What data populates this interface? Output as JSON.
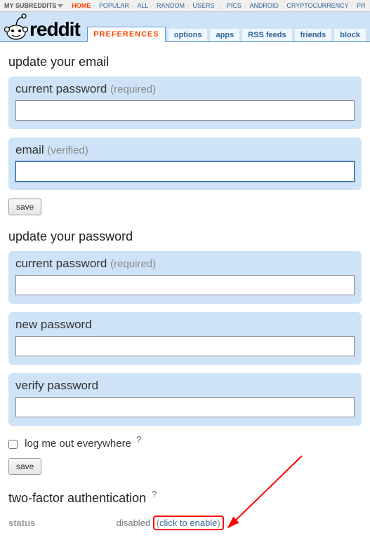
{
  "topbar": {
    "label": "MY SUBREDDITS",
    "links": [
      "HOME",
      "POPULAR",
      "ALL",
      "RANDOM",
      "USERS"
    ],
    "subs": [
      "PICS",
      "ANDROID",
      "CRYPTOCURRENCY",
      "PR"
    ]
  },
  "header": {
    "brand": "reddit",
    "active_tab": "PREFERENCES",
    "tabs": [
      "options",
      "apps",
      "RSS feeds",
      "friends",
      "block"
    ]
  },
  "email_section": {
    "title": "update your email",
    "pw": {
      "label": "current password",
      "hint": "(required)"
    },
    "email": {
      "label": "email",
      "hint": "(verified)"
    },
    "save": "save"
  },
  "pw_section": {
    "title": "update your password",
    "cur": {
      "label": "current password",
      "hint": "(required)"
    },
    "new": {
      "label": "new password"
    },
    "ver": {
      "label": "verify password"
    },
    "logout": "log me out everywhere",
    "q": "?",
    "save": "save"
  },
  "tfa": {
    "title": "two-factor authentication",
    "q": "?",
    "status_label": "status",
    "status_value": "disabled",
    "enable": "click to enable"
  }
}
